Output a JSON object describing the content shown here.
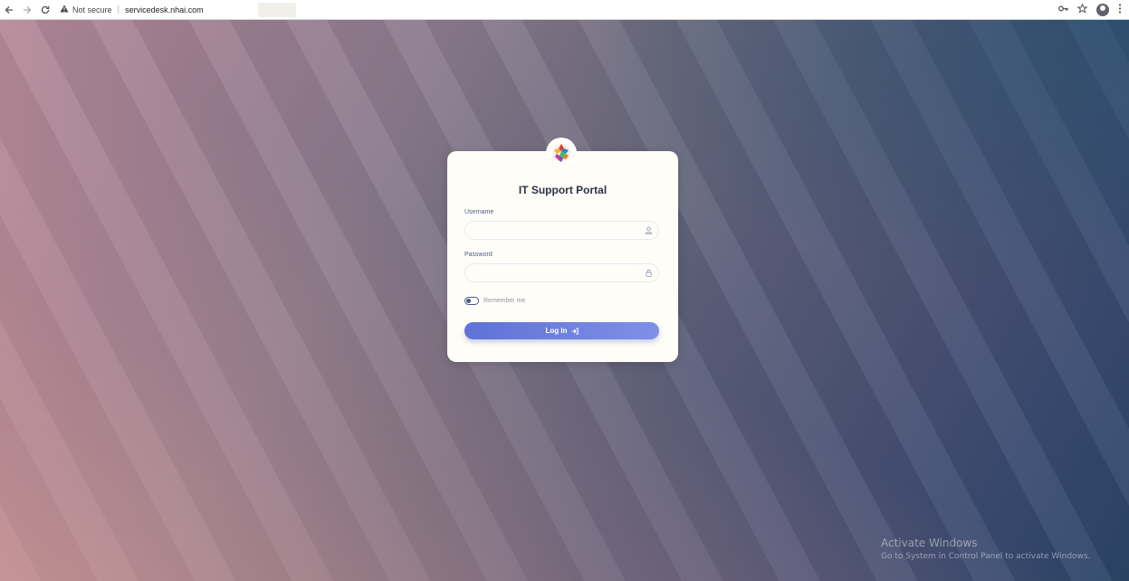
{
  "browser": {
    "back_icon": "arrow-left-icon",
    "forward_icon": "arrow-right-icon",
    "reload_icon": "reload-icon",
    "warning_icon": "warning-icon",
    "security_label": "Not secure",
    "separator": "|",
    "url": "servicedesk.nhai.com",
    "right_icons": [
      "key-icon",
      "star-icon",
      "profile-icon",
      "menu-dots-icon"
    ]
  },
  "login": {
    "title": "IT Support Portal",
    "username_label": "Username",
    "username_value": "",
    "password_label": "Password",
    "password_value": "",
    "remember_label": "Remember me",
    "remember_checked": false,
    "button_label": "Log In"
  },
  "watermark": {
    "title": "Activate Windows",
    "subtitle": "Go to System in Control Panel to activate Windows."
  }
}
